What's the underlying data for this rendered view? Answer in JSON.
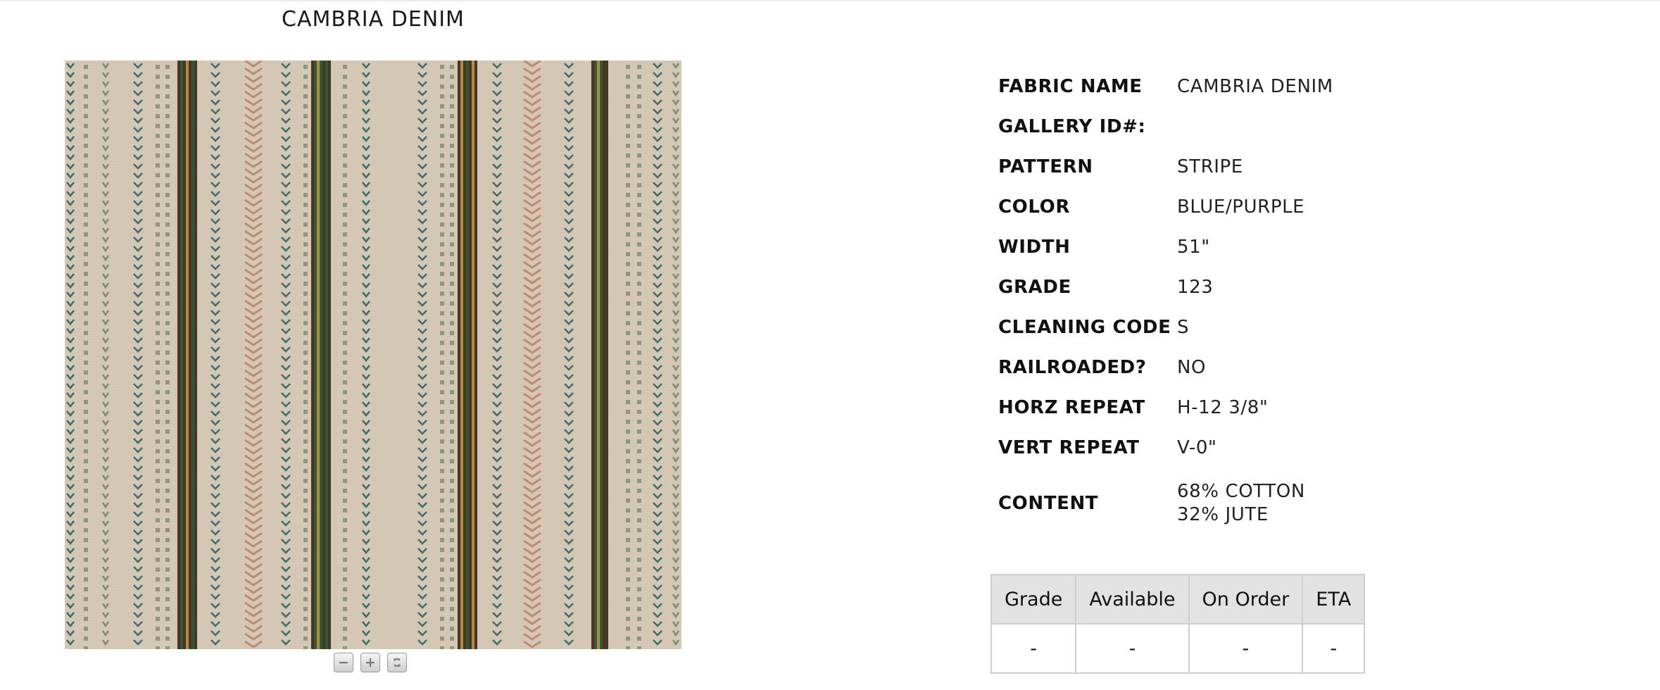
{
  "product": {
    "title": "CAMBRIA DENIM"
  },
  "swatch": {
    "alt": "stripe fabric swatch image",
    "colors": {
      "background": "#d5c9b6",
      "teal": "#3f6f72",
      "sage": "#7f8f76",
      "green": "#2f5a38",
      "brown": "#4a3524",
      "rust": "#c08a72",
      "gold": "#b38a3e"
    }
  },
  "zoom": {
    "zoom_out_icon": "minus-icon",
    "zoom_in_icon": "plus-icon",
    "reset_icon": "reset-icon"
  },
  "specs": [
    {
      "label": "FABRIC NAME",
      "value": "CAMBRIA DENIM"
    },
    {
      "label": "GALLERY ID#:",
      "value": ""
    },
    {
      "label": "PATTERN",
      "value": "STRIPE"
    },
    {
      "label": "COLOR",
      "value": "BLUE/PURPLE"
    },
    {
      "label": "WIDTH",
      "value": "51\""
    },
    {
      "label": "GRADE",
      "value": "123"
    },
    {
      "label": "CLEANING CODE",
      "value": "S"
    },
    {
      "label": "RAILROADED?",
      "value": "NO"
    },
    {
      "label": "HORZ REPEAT",
      "value": "H-12 3/8\""
    },
    {
      "label": "VERT REPEAT",
      "value": "V-0\""
    },
    {
      "label": "CONTENT",
      "value_lines": [
        "68% COTTON",
        "32% JUTE"
      ]
    }
  ],
  "stock": {
    "headers": [
      "Grade",
      "Available",
      "On Order",
      "ETA"
    ],
    "rows": [
      [
        "-",
        "-",
        "-",
        "-"
      ]
    ]
  }
}
